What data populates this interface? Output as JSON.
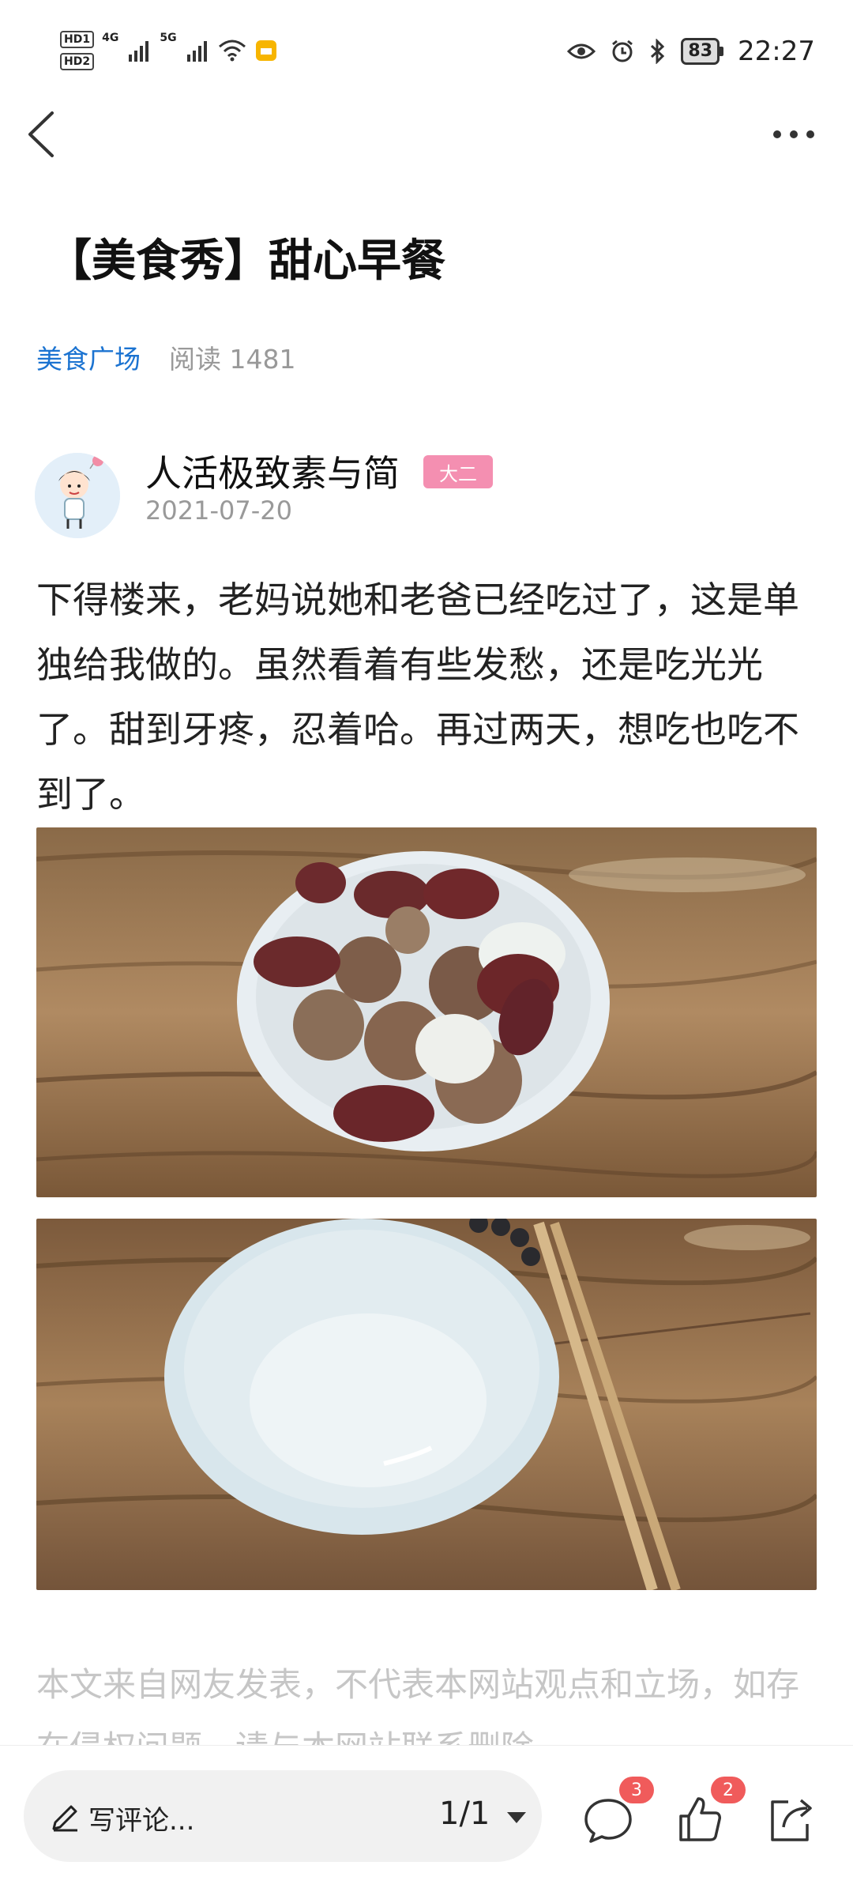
{
  "status_bar": {
    "hd1": "HD1",
    "hd2": "HD2",
    "sim1_type": "4G",
    "sim2_type": "5G",
    "battery": "83",
    "time": "22:27"
  },
  "article": {
    "title": "【美食秀】甜心早餐",
    "category": "美食广场",
    "reads": "阅读 1481",
    "author_name": "人活极致素与简",
    "author_badge": "大二",
    "date": "2021-07-20",
    "body": "下得楼来，老妈说她和老爸已经吃过了，这是单独给我做的。虽然看着有些发愁，还是吃光光了。甜到牙疼，忍着哈。再过两天，想吃也吃不到了。",
    "disclaimer": "本文来自网友发表，不代表本网站观点和立场，如存在侵权问题，请与本网站联系删除"
  },
  "bottom_bar": {
    "comment_placeholder": "写评论...",
    "page_indicator": "1/1",
    "comment_count": "3",
    "like_count": "2"
  },
  "colors": {
    "link": "#1b73d1",
    "badge": "#f48fb1",
    "count_badge": "#f05b5b"
  },
  "icons": [
    "back-icon",
    "more-icon",
    "eye-icon",
    "alarm-icon",
    "bluetooth-icon",
    "wifi-icon",
    "pencil-icon",
    "caret-down-icon",
    "comment-icon",
    "like-icon",
    "share-icon"
  ]
}
